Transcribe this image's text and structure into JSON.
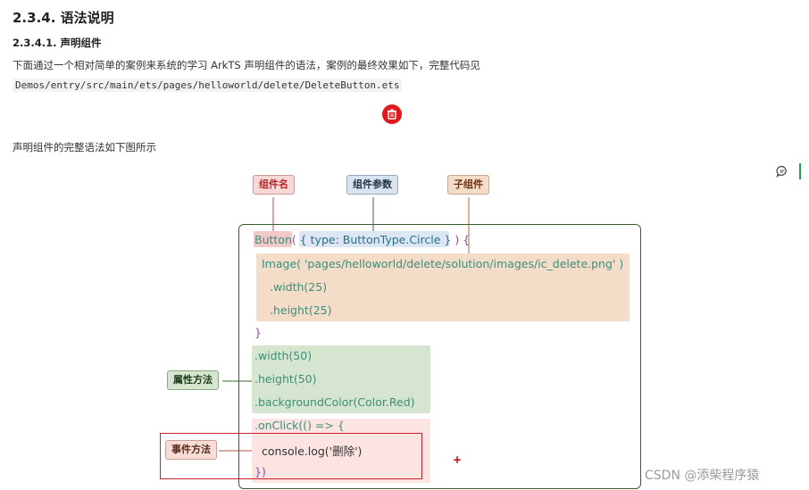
{
  "heading": "2.3.4. 语法说明",
  "subheading": "2.3.4.1. 声明组件",
  "intro_text": "下面通过一个相对简单的案例来系统的学习 ArkTS 声明组件的语法，案例的最终效果如下，完整代码见 ",
  "code_path": "Demos/entry/src/main/ets/pages/helloworld/delete/DeleteButton.ets",
  "delete_icon": "trash-icon",
  "diagram_intro": "声明组件的完整语法如下图所示",
  "labels": {
    "component_name": "组件名",
    "component_params": "组件参数",
    "child_component": "子组件",
    "attribute_methods": "属性方法",
    "event_methods": "事件方法"
  },
  "code": {
    "button_name": "Button",
    "button_open": "( ",
    "button_params": "{ type: ButtonType.Circle }",
    "button_close": " ) {",
    "image_line": "Image( 'pages/helloworld/delete/solution/images/ic_delete.png' )",
    "width25": ".width(25)",
    "height25": ".height(25)",
    "brace_close": "}",
    "width50": ".width(50)",
    "height50": ".height(50)",
    "bgcolor": ".backgroundColor(Color.Red)",
    "onclick": ".onClick(() => {",
    "console": "console.log('删除')",
    "onclick_close": "})"
  },
  "plus_mark": "+",
  "watermark": "CSDN @添柴程序猿",
  "colors": {
    "delete_button": "#e0191e",
    "name_label": "#f6d8d6",
    "params_label": "#d9e4f0",
    "child_label": "#f3dcc8",
    "attr_label": "#d5e5cf",
    "event_label": "#f6ddd8",
    "outer_border": "#3e5b2e",
    "event_highlight": "#c8232a"
  }
}
